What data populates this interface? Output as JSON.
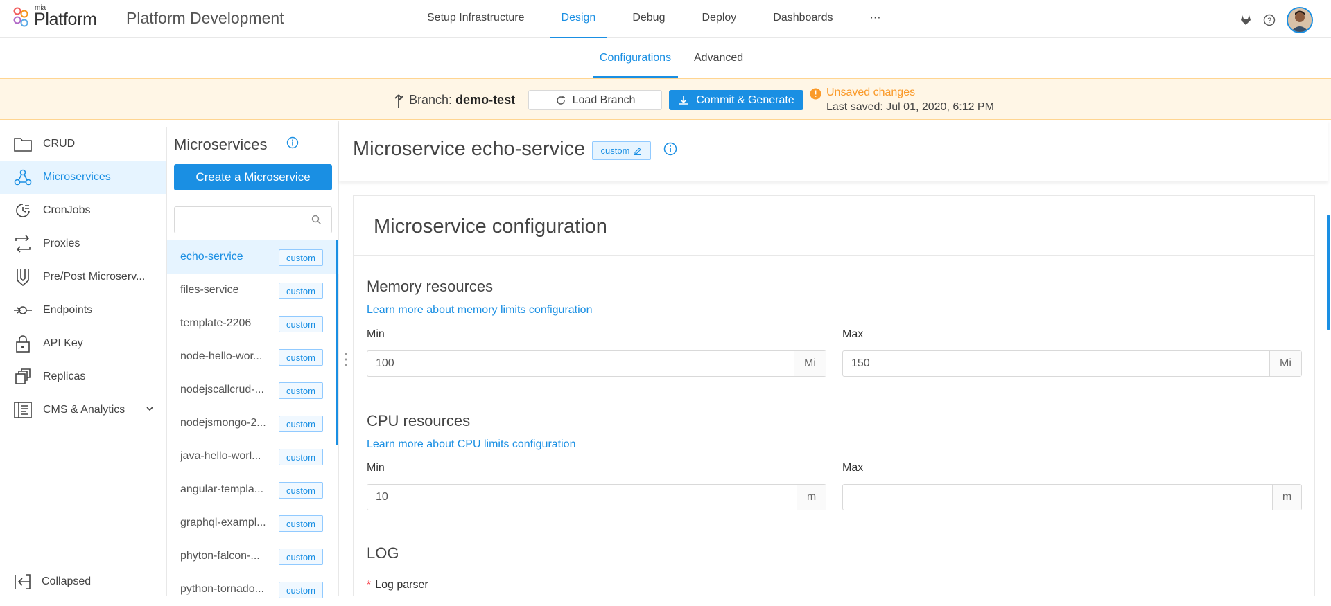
{
  "brand": {
    "small": "mia",
    "name": "Platform"
  },
  "project_title": "Platform Development",
  "main_nav": [
    "Setup Infrastructure",
    "Design",
    "Debug",
    "Deploy",
    "Dashboards",
    "···"
  ],
  "main_nav_active": "Design",
  "sub_tabs": [
    "Configurations",
    "Advanced"
  ],
  "branch": {
    "label": "Branch:",
    "name": "demo-test",
    "load_button": "Load Branch",
    "commit_button": "Commit & Generate",
    "unsaved": "Unsaved changes",
    "last_saved": "Last saved:  Jul 01, 2020, 6:12 PM"
  },
  "sidebar": {
    "items": [
      {
        "label": "CRUD",
        "icon": "folder-icon"
      },
      {
        "label": "Microservices",
        "icon": "microservices-icon"
      },
      {
        "label": "CronJobs",
        "icon": "cronjobs-icon"
      },
      {
        "label": "Proxies",
        "icon": "proxies-icon"
      },
      {
        "label": "Pre/Post Microserv...",
        "icon": "decorator-icon"
      },
      {
        "label": "Endpoints",
        "icon": "endpoints-icon"
      },
      {
        "label": "API Key",
        "icon": "lock-icon"
      },
      {
        "label": "Replicas",
        "icon": "replicas-icon"
      },
      {
        "label": "CMS & Analytics",
        "icon": "cms-icon"
      }
    ],
    "active": "Microservices",
    "collapse_label": "Collapsed"
  },
  "microservices": {
    "title": "Microservices",
    "create_button": "Create a Microservice",
    "search_placeholder": "",
    "items": [
      {
        "name": "echo-service",
        "tag": "custom"
      },
      {
        "name": "files-service",
        "tag": "custom"
      },
      {
        "name": "template-2206",
        "tag": "custom"
      },
      {
        "name": "node-hello-wor...",
        "tag": "custom"
      },
      {
        "name": "nodejscallcrud-...",
        "tag": "custom"
      },
      {
        "name": "nodejsmongo-2...",
        "tag": "custom"
      },
      {
        "name": "java-hello-worl...",
        "tag": "custom"
      },
      {
        "name": "angular-templa...",
        "tag": "custom"
      },
      {
        "name": "graphql-exampl...",
        "tag": "custom"
      },
      {
        "name": "phyton-falcon-...",
        "tag": "custom"
      },
      {
        "name": "python-tornado...",
        "tag": "custom"
      }
    ]
  },
  "main": {
    "title": "Microservice echo-service",
    "tag": "custom",
    "card_title": "Microservice configuration",
    "memory": {
      "title": "Memory resources",
      "link": "Learn more about memory limits configuration",
      "min_label": "Min",
      "min_value": "100",
      "min_unit": "Mi",
      "max_label": "Max",
      "max_value": "150",
      "max_unit": "Mi"
    },
    "cpu": {
      "title": "CPU resources",
      "link": "Learn more about CPU limits configuration",
      "min_label": "Min",
      "min_value": "10",
      "min_unit": "m",
      "max_label": "Max",
      "max_value": "",
      "max_unit": "m"
    },
    "log": {
      "title": "LOG",
      "parser_label": "Log parser"
    }
  },
  "colors": {
    "accent": "#1a8fe3",
    "warning": "#fa9a2a",
    "branch_bg": "#fff6e6"
  }
}
